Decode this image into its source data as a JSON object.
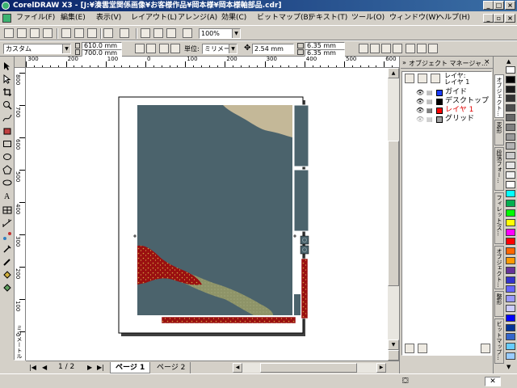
{
  "window": {
    "title": "CorelDRAW X3 - [J:¥湊雲堂関係画像¥お客様作品¥岡本様¥岡本様軸部品.cdr]",
    "controls": [
      "_",
      "□",
      "×"
    ],
    "doc_controls": [
      "_",
      "▫",
      "×"
    ]
  },
  "menu": {
    "items": [
      "ファイル(F)",
      "編集(E)",
      "表示(V)",
      "レイアウト(L)",
      "アレンジ(A)",
      "効果(C)",
      "ビットマップ(B)",
      "テキスト(T)",
      "ツール(O)",
      "ウィンドウ(W)",
      "ヘルプ(H)"
    ]
  },
  "toolbar": {
    "zoom": "100%"
  },
  "propbar": {
    "paper_type": "カスタム",
    "width": "610.0 mm",
    "height": "700.0 mm",
    "units_label": "単位:",
    "units": "ミリメートル",
    "nudge": "2.54 mm",
    "dup_x": "6.35 mm",
    "dup_y": "6.35 mm"
  },
  "ruler": {
    "h_labels": [
      "300",
      "200",
      "100",
      "0",
      "100",
      "200",
      "300",
      "400",
      "500",
      "600",
      "700"
    ],
    "v_labels": [
      "800",
      "700",
      "600",
      "500",
      "400",
      "300",
      "200",
      "100",
      "0",
      "ミリメートル"
    ]
  },
  "pages": {
    "counter": "1 / 2",
    "tabs": [
      "ページ 1",
      "ページ 2"
    ]
  },
  "docker": {
    "title": "オブジェクト マネージャ...",
    "layer_header_line1": "レイヤ:",
    "layer_header_line2": "レイヤ 1",
    "layers": [
      {
        "name": "ガイド",
        "color": "#1a3cff"
      },
      {
        "name": "デスクトップ",
        "color": "#000000"
      },
      {
        "name": "レイヤ 1",
        "color": "#ff0000"
      },
      {
        "name": "グリッド",
        "color": "#a0a0a0"
      }
    ],
    "side_tabs": [
      "オブジェクト...",
      "変形",
      "段落フォー...",
      "フィレット/ス...",
      "オブジェクト...",
      "整形",
      "ビットマップ..."
    ]
  },
  "palette": {
    "colors": [
      "#ffffff",
      "#000000",
      "#1a1a1a",
      "#333333",
      "#4d4d4d",
      "#666666",
      "#808080",
      "#999999",
      "#b3b3b3",
      "#cccccc",
      "#e6e6e6",
      "#f2f2f2",
      "#ffffff",
      "#00ffff",
      "#00b050",
      "#00ff00",
      "#ffff00",
      "#ff00ff",
      "#ff0000",
      "#ff6600",
      "#ff9900",
      "#663399",
      "#3333cc",
      "#6666ff",
      "#9999ff",
      "#ccccff",
      "#0000ff",
      "#003399",
      "#3366cc",
      "#66ccff",
      "#99ccff"
    ]
  },
  "colors": {
    "artwork_bg": "#4b636c",
    "tan": "#c4b898",
    "olive": "#8e9468",
    "brocade": "#9a1010",
    "selection": "#0a246a"
  }
}
